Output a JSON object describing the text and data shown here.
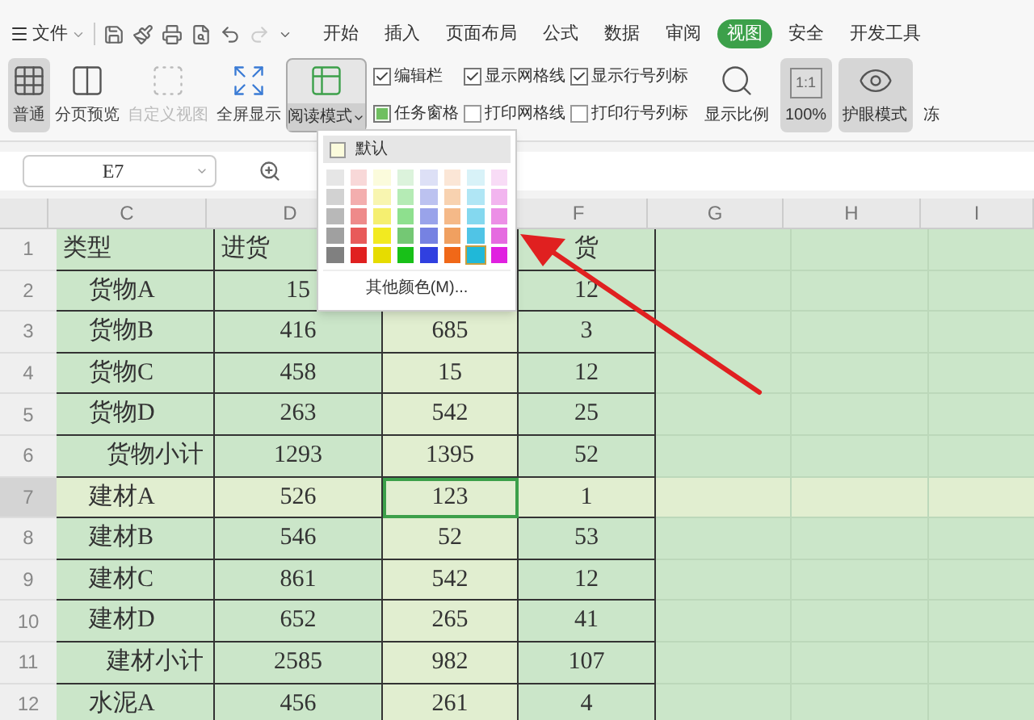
{
  "menu": {
    "file": "文件",
    "tabs": [
      {
        "label": "开始",
        "selected": false
      },
      {
        "label": "插入",
        "selected": false
      },
      {
        "label": "页面布局",
        "selected": false
      },
      {
        "label": "公式",
        "selected": false
      },
      {
        "label": "数据",
        "selected": false
      },
      {
        "label": "审阅",
        "selected": false
      },
      {
        "label": "视图",
        "selected": true
      },
      {
        "label": "安全",
        "selected": false
      },
      {
        "label": "开发工具",
        "selected": false
      }
    ]
  },
  "ribbon": {
    "views": [
      {
        "label": "普通",
        "selected": true,
        "disabled": false
      },
      {
        "label": "分页预览",
        "selected": false,
        "disabled": false
      },
      {
        "label": "自定义视图",
        "selected": false,
        "disabled": true
      },
      {
        "label": "全屏显示",
        "selected": false,
        "disabled": false
      }
    ],
    "reading_mode": {
      "label": "阅读模式",
      "expanded": true
    },
    "checkbox_columns": [
      [
        {
          "label": "编辑栏",
          "kind": "tick",
          "checked": true
        },
        {
          "label": "任务窗格",
          "kind": "fill",
          "checked": true
        }
      ],
      [
        {
          "label": "显示网格线",
          "kind": "tick",
          "checked": true
        },
        {
          "label": "打印网格线",
          "kind": "tick",
          "checked": false
        }
      ],
      [
        {
          "label": "显示行号列标",
          "kind": "tick",
          "checked": true
        },
        {
          "label": "打印行号列标",
          "kind": "tick",
          "checked": false
        }
      ]
    ],
    "zoom_buttons": [
      {
        "label": "显示比例",
        "selected": false
      },
      {
        "label": "100%",
        "icon_text": "1:1",
        "selected": true
      },
      {
        "label": "护眼模式",
        "selected": true
      },
      {
        "label": "冻",
        "selected": false
      }
    ]
  },
  "name_box": "E7",
  "columns": [
    {
      "label": "C"
    },
    {
      "label": "D"
    },
    {
      "label": "F"
    },
    {
      "label": "G"
    },
    {
      "label": "H"
    },
    {
      "label": "I"
    }
  ],
  "rows": [
    {
      "number": "1",
      "selected": false,
      "cells": [
        {
          "text": "类型",
          "kind": "head"
        },
        {
          "text": "进货",
          "kind": "head"
        },
        {
          "text": "",
          "kind": "hidden"
        },
        {
          "text": "货",
          "kind": "tail"
        }
      ]
    },
    {
      "number": "2",
      "selected": false,
      "cells": [
        {
          "text": "货物A",
          "kind": "item"
        },
        {
          "text": "15",
          "kind": "num"
        },
        {
          "text": "",
          "kind": "hidden"
        },
        {
          "text": "12",
          "kind": "num"
        }
      ]
    },
    {
      "number": "3",
      "selected": false,
      "cells": [
        {
          "text": "货物B",
          "kind": "item"
        },
        {
          "text": "416",
          "kind": "num"
        },
        {
          "text": "685",
          "kind": "num"
        },
        {
          "text": "3",
          "kind": "num"
        }
      ]
    },
    {
      "number": "4",
      "selected": false,
      "cells": [
        {
          "text": "货物C",
          "kind": "item"
        },
        {
          "text": "458",
          "kind": "num"
        },
        {
          "text": "15",
          "kind": "num"
        },
        {
          "text": "12",
          "kind": "num"
        }
      ]
    },
    {
      "number": "5",
      "selected": false,
      "cells": [
        {
          "text": "货物D",
          "kind": "item"
        },
        {
          "text": "263",
          "kind": "num"
        },
        {
          "text": "542",
          "kind": "num"
        },
        {
          "text": "25",
          "kind": "num"
        }
      ]
    },
    {
      "number": "6",
      "selected": false,
      "cells": [
        {
          "text": "货物小计",
          "kind": "subtotal"
        },
        {
          "text": "1293",
          "kind": "num"
        },
        {
          "text": "1395",
          "kind": "num"
        },
        {
          "text": "52",
          "kind": "num"
        }
      ]
    },
    {
      "number": "7",
      "selected": true,
      "cells": [
        {
          "text": "建材A",
          "kind": "item"
        },
        {
          "text": "526",
          "kind": "num"
        },
        {
          "text": "123",
          "kind": "num",
          "selected": true
        },
        {
          "text": "1",
          "kind": "num"
        }
      ]
    },
    {
      "number": "8",
      "selected": false,
      "cells": [
        {
          "text": "建材B",
          "kind": "item"
        },
        {
          "text": "546",
          "kind": "num"
        },
        {
          "text": "52",
          "kind": "num",
          "selected": false
        },
        {
          "text": "53",
          "kind": "num"
        }
      ]
    },
    {
      "number": "9",
      "selected": false,
      "cells": [
        {
          "text": "建材C",
          "kind": "item"
        },
        {
          "text": "861",
          "kind": "num"
        },
        {
          "text": "542",
          "kind": "num",
          "selected": false
        },
        {
          "text": "12",
          "kind": "num"
        }
      ]
    },
    {
      "number": "10",
      "selected": false,
      "cells": [
        {
          "text": "建材D",
          "kind": "item"
        },
        {
          "text": "652",
          "kind": "num"
        },
        {
          "text": "265",
          "kind": "num",
          "selected": false
        },
        {
          "text": "41",
          "kind": "num"
        }
      ]
    },
    {
      "number": "11",
      "selected": false,
      "cells": [
        {
          "text": "建材小计",
          "kind": "subtotal"
        },
        {
          "text": "2585",
          "kind": "num"
        },
        {
          "text": "982",
          "kind": "num",
          "selected": false
        },
        {
          "text": "107",
          "kind": "num"
        }
      ]
    },
    {
      "number": "12",
      "selected": false,
      "cells": [
        {
          "text": "水泥A",
          "kind": "item"
        },
        {
          "text": "456",
          "kind": "num"
        },
        {
          "text": "261",
          "kind": "num",
          "selected": false
        },
        {
          "text": "4",
          "kind": "num"
        }
      ]
    }
  ],
  "color_menu": {
    "default_label": "默认",
    "more_label": "其他颜色(M)...",
    "swatch_rows": [
      [
        {
          "color": "#e6e6e6",
          "selected": false
        },
        {
          "color": "#f8d8d8",
          "selected": false
        },
        {
          "color": "#fbfbdc",
          "selected": false
        },
        {
          "color": "#dcf3dc",
          "selected": false
        },
        {
          "color": "#dde0f6",
          "selected": false
        },
        {
          "color": "#fbe6d6",
          "selected": false
        },
        {
          "color": "#d8f2f8",
          "selected": false
        },
        {
          "color": "#f8dcf6",
          "selected": false
        }
      ],
      [
        {
          "color": "#d2d2d2",
          "selected": false
        },
        {
          "color": "#f3aeae",
          "selected": false
        },
        {
          "color": "#f8f5b0",
          "selected": false
        },
        {
          "color": "#b5ebb5",
          "selected": false
        },
        {
          "color": "#bcc2f0",
          "selected": false
        },
        {
          "color": "#f8d2b0",
          "selected": false
        },
        {
          "color": "#b0e6f5",
          "selected": false
        },
        {
          "color": "#f2b5ef",
          "selected": false
        }
      ],
      [
        {
          "color": "#b8b8b8",
          "selected": false
        },
        {
          "color": "#ee8a8a",
          "selected": false
        },
        {
          "color": "#f5ef70",
          "selected": false
        },
        {
          "color": "#8ee08e",
          "selected": false
        },
        {
          "color": "#99a3ea",
          "selected": false
        },
        {
          "color": "#f5b988",
          "selected": false
        },
        {
          "color": "#84d8ef",
          "selected": false
        },
        {
          "color": "#ec8fe6",
          "selected": false
        }
      ],
      [
        {
          "color": "#a0a0a0",
          "selected": false
        },
        {
          "color": "#e85a5a",
          "selected": false
        },
        {
          "color": "#f2ea20",
          "selected": false
        },
        {
          "color": "#74c874",
          "selected": false
        },
        {
          "color": "#7682e2",
          "selected": false
        },
        {
          "color": "#f0a060",
          "selected": false
        },
        {
          "color": "#50c4e6",
          "selected": false
        },
        {
          "color": "#e56be0",
          "selected": false
        }
      ],
      [
        {
          "color": "#808080",
          "selected": false
        },
        {
          "color": "#e02020",
          "selected": false
        },
        {
          "color": "#e6dc00",
          "selected": false
        },
        {
          "color": "#18c018",
          "selected": false
        },
        {
          "color": "#3040e0",
          "selected": false
        },
        {
          "color": "#f06818",
          "selected": false
        },
        {
          "color": "#20b8d8",
          "selected": true
        },
        {
          "color": "#e020e0",
          "selected": false
        }
      ]
    ]
  }
}
